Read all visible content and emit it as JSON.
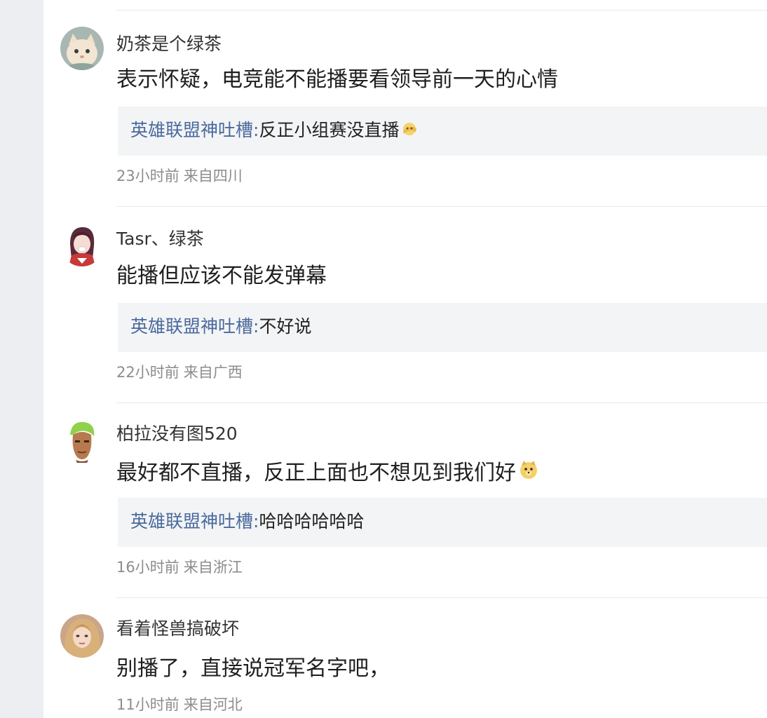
{
  "comments": [
    {
      "username": "奶茶是个绿茶",
      "avatar_icon": "cat-avatar",
      "content": "表示怀疑，电竞能不能播要看领导前一天的心情",
      "reply": {
        "author": "英雄联盟神吐槽",
        "colon": ":",
        "text": "反正小组赛没直播",
        "emoji": "thinking-emoji"
      },
      "time": "23小时前",
      "location": "来自四川"
    },
    {
      "username": "Tasr、绿茶",
      "avatar_icon": "anime-girl-avatar",
      "content": "能播但应该不能发弹幕",
      "reply": {
        "author": "英雄联盟神吐槽",
        "colon": ":",
        "text": "不好说"
      },
      "time": "22小时前",
      "location": "来自广西"
    },
    {
      "username": "柏拉没有图520",
      "avatar_icon": "green-hair-avatar",
      "content": "最好都不直播，反正上面也不想见到我们好",
      "content_emoji": "doge-emoji",
      "reply": {
        "author": "英雄联盟神吐槽",
        "colon": ":",
        "text": "哈哈哈哈哈哈"
      },
      "time": "16小时前",
      "location": "来自浙江"
    },
    {
      "username": "看着怪兽搞破坏",
      "avatar_icon": "blonde-girl-avatar",
      "content": "别播了，直接说冠军名字吧，",
      "time": "11小时前",
      "location": "来自河北"
    }
  ],
  "colors": {
    "reply_author": "#4a6a9c",
    "reply_background": "#f3f4f6",
    "meta_text": "#8c8c8c",
    "divider": "#e6e8eb"
  }
}
